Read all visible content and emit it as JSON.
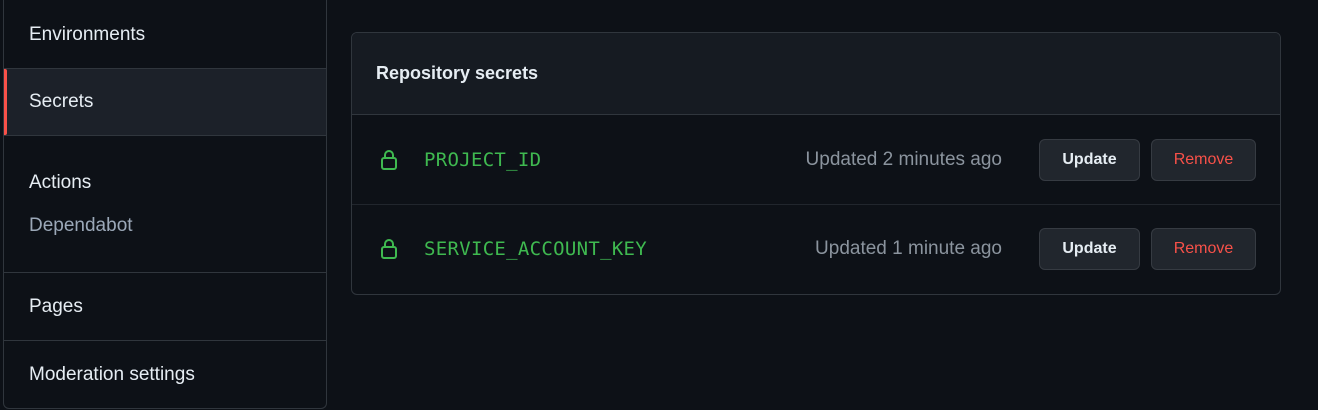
{
  "sidebar": {
    "items": {
      "environments": "Environments",
      "secrets": "Secrets",
      "pages": "Pages",
      "moderation": "Moderation settings"
    },
    "group": {
      "heading": "Actions",
      "dependabot": "Dependabot"
    },
    "active_item": "Secrets",
    "active_indicator_color": "#f85149"
  },
  "panel": {
    "title": "Repository secrets",
    "rows": [
      {
        "icon": "lock-icon",
        "name": "PROJECT_ID",
        "updated": "Updated 2 minutes ago",
        "update_label": "Update",
        "remove_label": "Remove"
      },
      {
        "icon": "lock-icon",
        "name": "SERVICE_ACCOUNT_KEY",
        "updated": "Updated 1 minute ago",
        "update_label": "Update",
        "remove_label": "Remove"
      }
    ]
  },
  "colors": {
    "background": "#0d1117",
    "secret_name": "#3fb950",
    "remove_text": "#f85149",
    "muted_text": "#8b949e"
  }
}
